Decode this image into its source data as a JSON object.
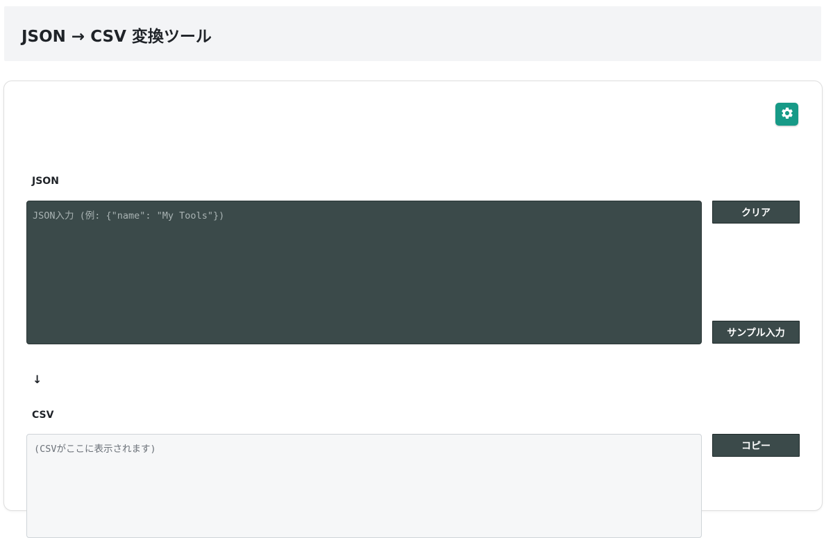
{
  "header": {
    "title": "JSON → CSV 変換ツール"
  },
  "settings": {
    "icon": "gear-icon",
    "accent_color": "#179a87"
  },
  "json_section": {
    "label": "JSON",
    "placeholder": "JSON入力 (例: {\"name\": \"My Tools\"})",
    "value": "",
    "buttons": {
      "clear": "クリア",
      "sample": "サンプル入力"
    }
  },
  "arrow": "↓",
  "csv_section": {
    "label": "CSV",
    "placeholder": "(CSVがここに表示されます)",
    "value": "",
    "buttons": {
      "copy": "コピー"
    }
  },
  "colors": {
    "header_bg": "#f3f4f6",
    "dark_panel": "#3b4a4a",
    "csv_bg": "#f6f7f8"
  }
}
